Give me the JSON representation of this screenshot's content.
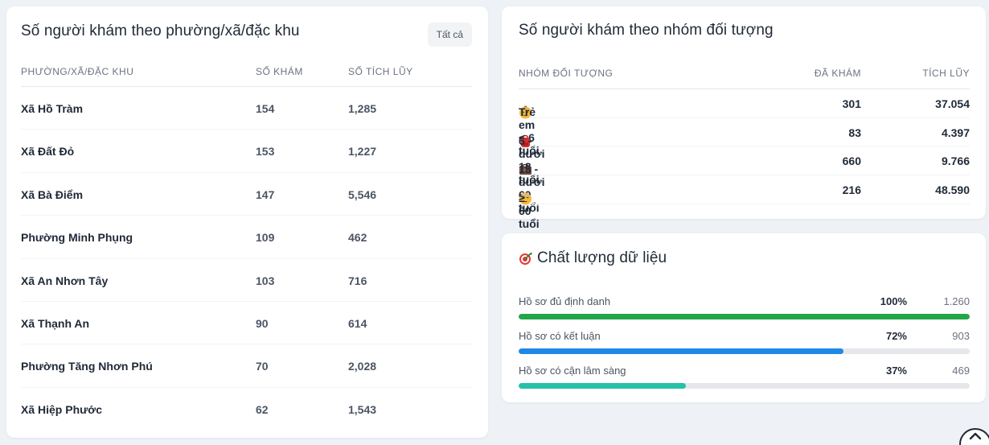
{
  "wards_card": {
    "title": "Số người khám theo phường/xã/đặc khu",
    "all_button": "Tất cả",
    "headers": [
      "PHƯỜNG/XÃ/ĐẶC KHU",
      "SỐ KHÁM",
      "SỐ TÍCH LŨY"
    ],
    "rows": [
      {
        "name": "Xã Hồ Tràm",
        "visits": "154",
        "cumulative": "1,285"
      },
      {
        "name": "Xã Đất Đỏ",
        "visits": "153",
        "cumulative": "1,227"
      },
      {
        "name": "Xã Bà Điểm",
        "visits": "147",
        "cumulative": "5,546"
      },
      {
        "name": "Phường Minh Phụng",
        "visits": "109",
        "cumulative": "462"
      },
      {
        "name": "Xã An Nhơn Tây",
        "visits": "103",
        "cumulative": "716"
      },
      {
        "name": "Xã Thạnh An",
        "visits": "90",
        "cumulative": "614"
      },
      {
        "name": "Phường Tăng Nhơn Phú",
        "visits": "70",
        "cumulative": "2,028"
      },
      {
        "name": "Xã Hiệp Phước",
        "visits": "62",
        "cumulative": "1,543"
      }
    ]
  },
  "groups_card": {
    "title": "Số người khám theo nhóm đối tượng",
    "headers": [
      "NHÓM ĐỐI TƯỢNG",
      "ĐÃ KHÁM",
      "TÍCH LŨY"
    ],
    "rows": [
      {
        "icon": "baby-face-icon",
        "label": "Trẻ em < 6 tuổi",
        "visited": "301",
        "cumulative": "37.054"
      },
      {
        "icon": "school-bag-icon",
        "label": "6 - dưới 18 tuổi",
        "visited": "83",
        "cumulative": "4.397"
      },
      {
        "icon": "briefcase-icon",
        "label": "18 - dưới 60 tuổi",
        "visited": "660",
        "cumulative": "9.766"
      },
      {
        "icon": "elder-face-icon",
        "label": "≥ 60 tuổi",
        "visited": "216",
        "cumulative": "48.590"
      }
    ]
  },
  "quality_card": {
    "title_icon": "target-icon",
    "title": "Chất lượng dữ liệu",
    "items": [
      {
        "label": "Hồ sơ đủ định danh",
        "percent_text": "100%",
        "fraction": 1.0,
        "count": "1.260",
        "color": "#22a64a"
      },
      {
        "label": "Hồ sơ có kết luận",
        "percent_text": "72%",
        "fraction": 0.72,
        "count": "903",
        "color": "#1e88e5"
      },
      {
        "label": "Hồ sơ có cận lâm sàng",
        "percent_text": "37%",
        "fraction": 0.37,
        "count": "469",
        "color": "#26c1a8"
      }
    ]
  },
  "scroll_top_icon": "chevron-up-icon"
}
